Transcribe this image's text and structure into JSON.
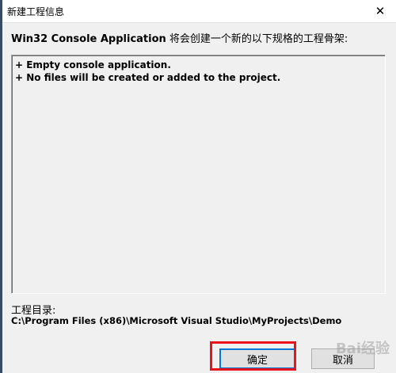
{
  "window": {
    "title": "新建工程信息",
    "close_symbol": "✕"
  },
  "heading": {
    "app_name": "Win32 Console Application",
    "description": " 将会创建一个新的以下规格的工程骨架:"
  },
  "info_lines": [
    "+ Empty console application.",
    "+ No files will be created or added to the project."
  ],
  "project_dir": {
    "label": "工程目录:",
    "path": "C:\\Program Files (x86)\\Microsoft Visual Studio\\MyProjects\\Demo"
  },
  "buttons": {
    "ok_label": "确定",
    "cancel_label": "取消"
  },
  "watermark": "Bai经验",
  "colors": {
    "highlight": "#e8141a",
    "focus": "#0078d7"
  }
}
